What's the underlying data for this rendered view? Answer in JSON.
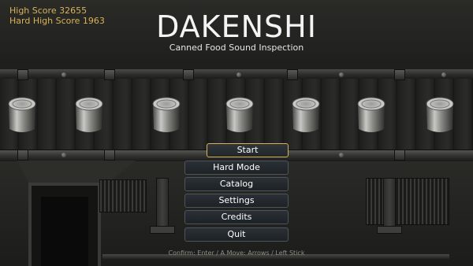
{
  "scores": {
    "high_score": "High Score 32655",
    "hard_high_score": "Hard High Score 1963"
  },
  "title": {
    "main": "DAKENSHI",
    "subtitle": "Canned Food Sound Inspection"
  },
  "menu": {
    "selected_index": 0,
    "items": [
      {
        "label": "Start"
      },
      {
        "label": "Hard Mode"
      },
      {
        "label": "Catalog"
      },
      {
        "label": "Settings"
      },
      {
        "label": "Credits"
      },
      {
        "label": "Quit"
      }
    ]
  },
  "controls_hint": "Confirm: Enter / A   Move: Arrows / Left Stick",
  "colors": {
    "score_text": "#d9b25a",
    "selection_border": "#d9b25a",
    "button_fill": "#22272b",
    "background": "#1f1f1d"
  },
  "scene": {
    "can_count": 7,
    "icons": [
      "tin-can-icon",
      "hopper-chute-icon",
      "vent-grille-icon"
    ]
  }
}
